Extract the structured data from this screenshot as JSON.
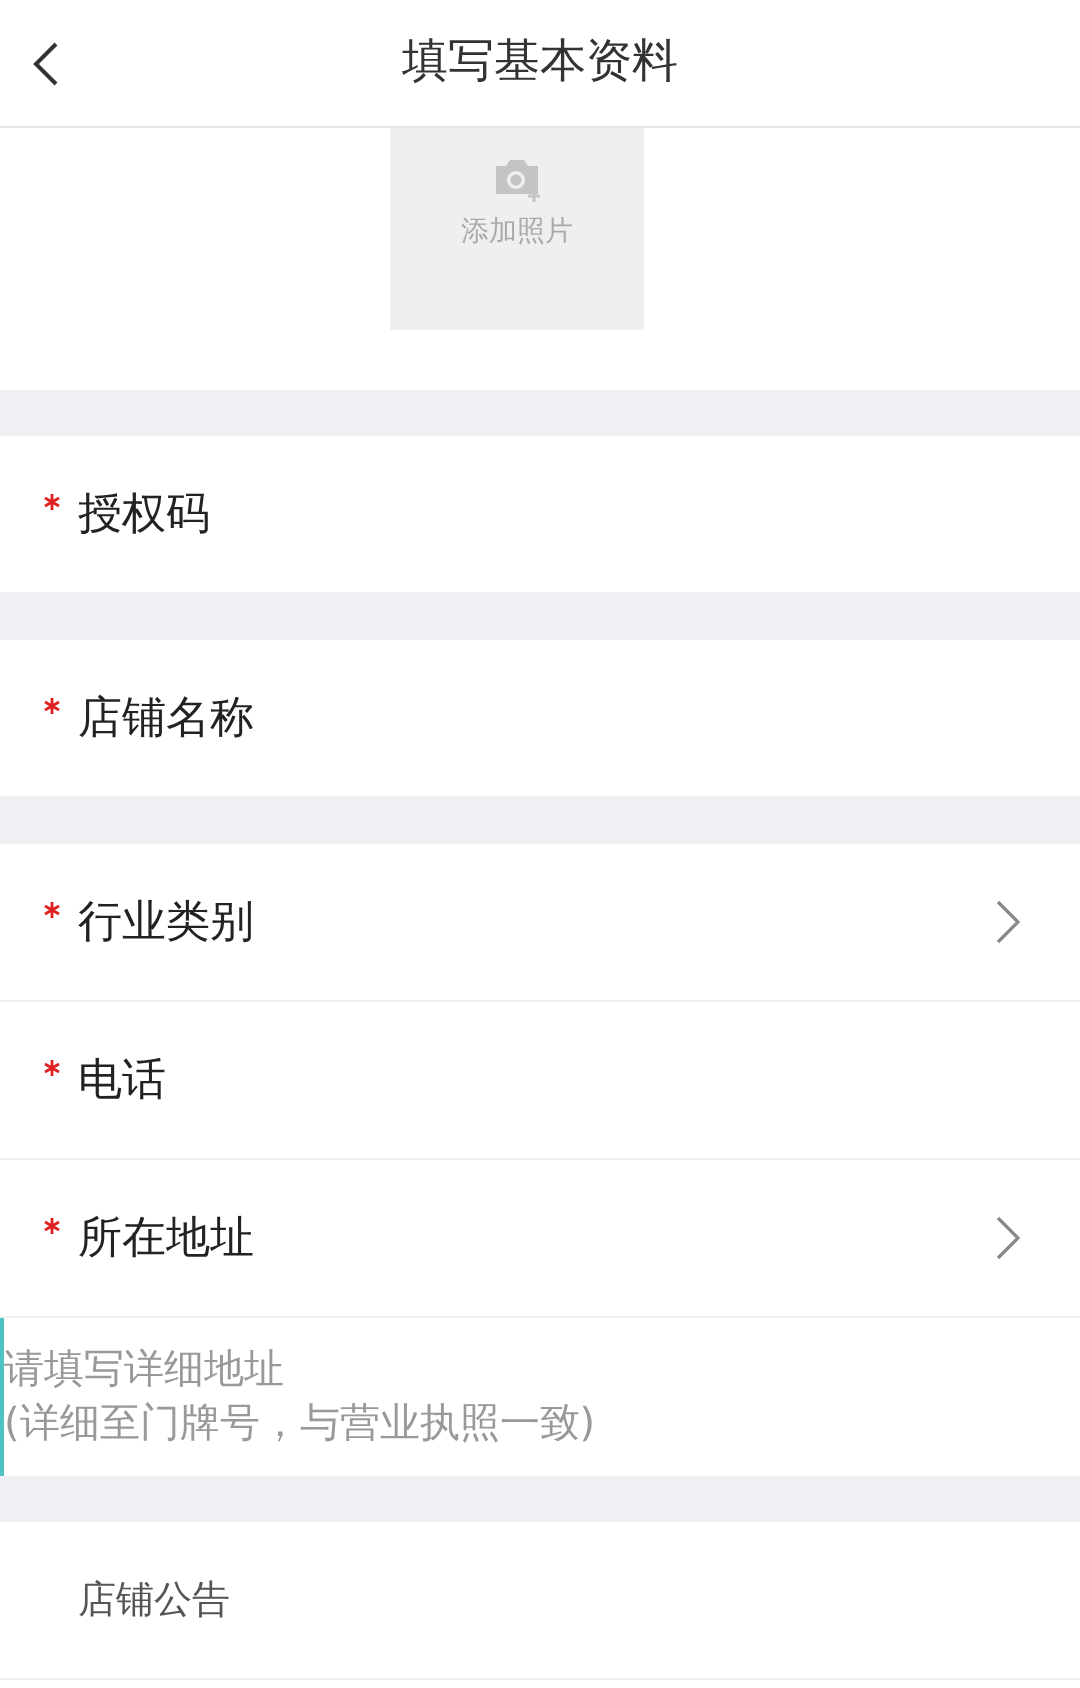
{
  "header": {
    "title": "填写基本资料"
  },
  "photo_upload": {
    "label": "添加照片"
  },
  "groups": [
    {
      "rows": [
        {
          "label": "授权码",
          "required": true,
          "chevron": false
        }
      ]
    },
    {
      "rows": [
        {
          "label": "店铺名称",
          "required": true,
          "chevron": false
        }
      ]
    },
    {
      "rows": [
        {
          "label": "行业类别",
          "required": true,
          "chevron": true
        },
        {
          "label": "电话",
          "required": true,
          "chevron": false
        },
        {
          "label": "所在地址",
          "required": true,
          "chevron": true
        }
      ],
      "address": {
        "placeholder": "请填写详细地址\n(详细至门牌号，与营业执照一致)"
      }
    },
    {
      "rows": [
        {
          "label": "店铺公告",
          "required": false,
          "chevron": false
        }
      ]
    }
  ]
}
